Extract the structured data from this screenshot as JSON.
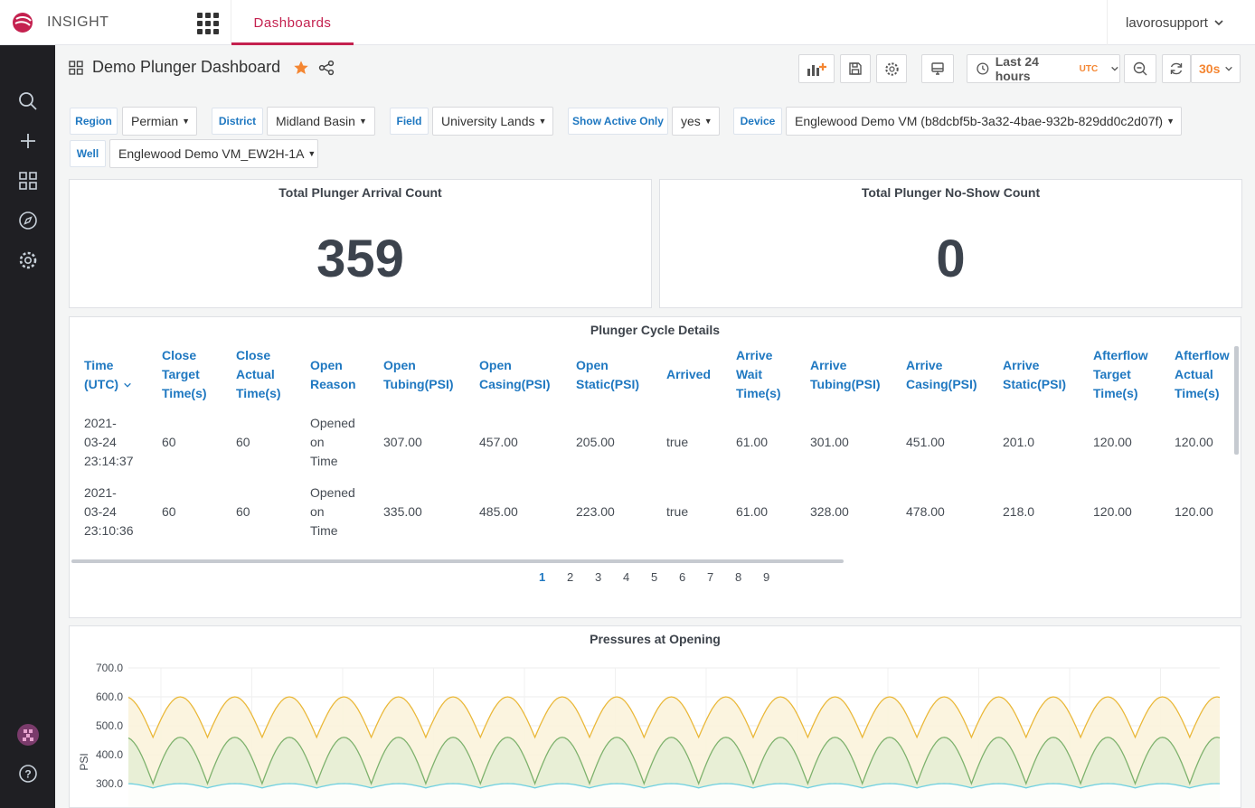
{
  "app": {
    "name": "INSIGHT",
    "nav_tab": "Dashboards",
    "user": "lavorosupport"
  },
  "sidebar": {
    "icons": [
      "search-icon",
      "plus-icon",
      "dashboards-icon",
      "explore-icon",
      "gear-icon",
      "avatar",
      "help-icon"
    ]
  },
  "dashboard": {
    "title": "Demo Plunger Dashboard",
    "time_range": "Last 24 hours",
    "timezone": "UTC",
    "refresh": "30s"
  },
  "variables": {
    "region": {
      "label": "Region",
      "value": "Permian"
    },
    "district": {
      "label": "District",
      "value": "Midland Basin"
    },
    "field": {
      "label": "Field",
      "value": "University Lands"
    },
    "show_active": {
      "label": "Show Active Only",
      "value": "yes"
    },
    "device": {
      "label": "Device",
      "value": "Englewood Demo VM (b8dcbf5b-3a32-4bae-932b-829dd0c2d07f)"
    },
    "well": {
      "label": "Well",
      "value": "Englewood Demo VM_EW2H-1A"
    }
  },
  "stats": {
    "arrival": {
      "title": "Total Plunger Arrival Count",
      "value": "359"
    },
    "noshow": {
      "title": "Total Plunger No-Show Count",
      "value": "0"
    }
  },
  "table": {
    "title": "Plunger Cycle Details",
    "columns": [
      [
        "Time",
        "(UTC)"
      ],
      [
        "Close",
        "Target",
        "Time(s)"
      ],
      [
        "Close",
        "Actual",
        "Time(s)"
      ],
      [
        "Open",
        "Reason"
      ],
      [
        "Open",
        "Tubing(PSI)"
      ],
      [
        "Open",
        "Casing(PSI)"
      ],
      [
        "Open",
        "Static(PSI)"
      ],
      [
        "Arrived"
      ],
      [
        "Arrive",
        "Wait",
        "Time(s)"
      ],
      [
        "Arrive",
        "Tubing(PSI)"
      ],
      [
        "Arrive",
        "Casing(PSI)"
      ],
      [
        "Arrive",
        "Static(PSI)"
      ],
      [
        "Afterflow",
        "Target",
        "Time(s)"
      ],
      [
        "Afterflow",
        "Actual",
        "Time(s)"
      ]
    ],
    "rows": [
      [
        [
          "2021-",
          "03-24",
          "23:14:37"
        ],
        [
          "60"
        ],
        [
          "60"
        ],
        [
          "Opened",
          "on",
          "Time"
        ],
        [
          "307.00"
        ],
        [
          "457.00"
        ],
        [
          "205.00"
        ],
        [
          "true"
        ],
        [
          "61.00"
        ],
        [
          "301.00"
        ],
        [
          "451.00"
        ],
        [
          "201.0"
        ],
        [
          "120.00"
        ],
        [
          "120.00"
        ]
      ],
      [
        [
          "2021-",
          "03-24",
          "23:10:36"
        ],
        [
          "60"
        ],
        [
          "60"
        ],
        [
          "Opened",
          "on",
          "Time"
        ],
        [
          "335.00"
        ],
        [
          "485.00"
        ],
        [
          "223.00"
        ],
        [
          "true"
        ],
        [
          "61.00"
        ],
        [
          "328.00"
        ],
        [
          "478.00"
        ],
        [
          "218.0"
        ],
        [
          "120.00"
        ],
        [
          "120.00"
        ]
      ]
    ],
    "pages": [
      "1",
      "2",
      "3",
      "4",
      "5",
      "6",
      "7",
      "8",
      "9"
    ]
  },
  "chart_data": {
    "type": "area",
    "title": "Pressures at Opening",
    "ylabel": "PSI",
    "xlabel": "",
    "ylim": [
      300,
      700
    ],
    "yticks": [
      "700.0",
      "600.0",
      "500.0",
      "400.0",
      "300.0"
    ],
    "grid": true,
    "cycles": 20,
    "series": [
      {
        "color": "#eab839",
        "fill": "#fbf3dc",
        "min": 460,
        "max": 600
      },
      {
        "color": "#7eb26d",
        "fill": "#e5eed5",
        "min": 300,
        "max": 460
      },
      {
        "color": "#6ed0e0",
        "fill": "#ffffff",
        "min": 285,
        "max": 300
      }
    ]
  }
}
